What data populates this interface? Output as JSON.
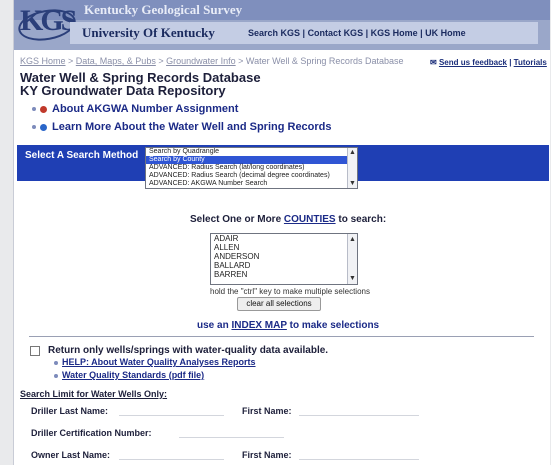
{
  "header": {
    "kgs_title": "Kentucky Geological Survey",
    "logo_text": "KGS",
    "uk_title": "University Of Kentucky",
    "nav": [
      "Search KGS",
      "Contact KGS",
      "KGS Home",
      "UK Home"
    ]
  },
  "breadcrumb": {
    "items": [
      "KGS Home",
      "Data, Maps, & Pubs",
      "Groundwater Info"
    ],
    "current": "Water Well & Spring Records Database"
  },
  "feedback": {
    "send_feedback": "Send us feedback",
    "tutorials": "Tutorials"
  },
  "page_title": "Water Well & Spring Records Database",
  "page_subtitle": "KY Groundwater Data Repository",
  "info_links": [
    {
      "label": "About AKGWA Number Assignment",
      "color": "#c0392b"
    },
    {
      "label": "Learn More About the Water Well and Spring Records",
      "color": "#2a66c9"
    }
  ],
  "search_method": {
    "label": "Select A Search Method",
    "options": [
      "Search by Quadrangle",
      "Search by County",
      "ADVANCED: Radius Search (lat/long coordinates)",
      "ADVANCED: Radius Search (decimal degree coordinates)",
      "ADVANCED: AKGWA Number Search"
    ],
    "selected": "Search by County"
  },
  "counties": {
    "title_prefix": "Select One or More",
    "title_link": "COUNTIES",
    "title_suffix": "to search:",
    "options": [
      "ADAIR",
      "ALLEN",
      "ANDERSON",
      "BALLARD",
      "BARREN"
    ],
    "hint": "hold the \"ctrl\" key to make multiple selections",
    "clear_button": "clear all selections",
    "index_prefix": "use an",
    "index_link": "INDEX MAP",
    "index_suffix": "to make selections"
  },
  "water_quality": {
    "checkbox_label": "Return only wells/springs with water-quality data available.",
    "help_link": "HELP: About Water Quality Analyses Reports",
    "standards_link": "Water Quality Standards (pdf file)"
  },
  "search_limit": {
    "heading": "Search Limit for Water Wells Only:",
    "driller_last": "Driller Last Name:",
    "driller_first": "First Name:",
    "driller_cert": "Driller Certification Number:",
    "owner_last": "Owner Last Name:",
    "owner_first": "First Name:"
  },
  "colors": {
    "banner": "#9aa7c9",
    "method_bar": "#1f3fb4",
    "link": "#1b2a87"
  }
}
